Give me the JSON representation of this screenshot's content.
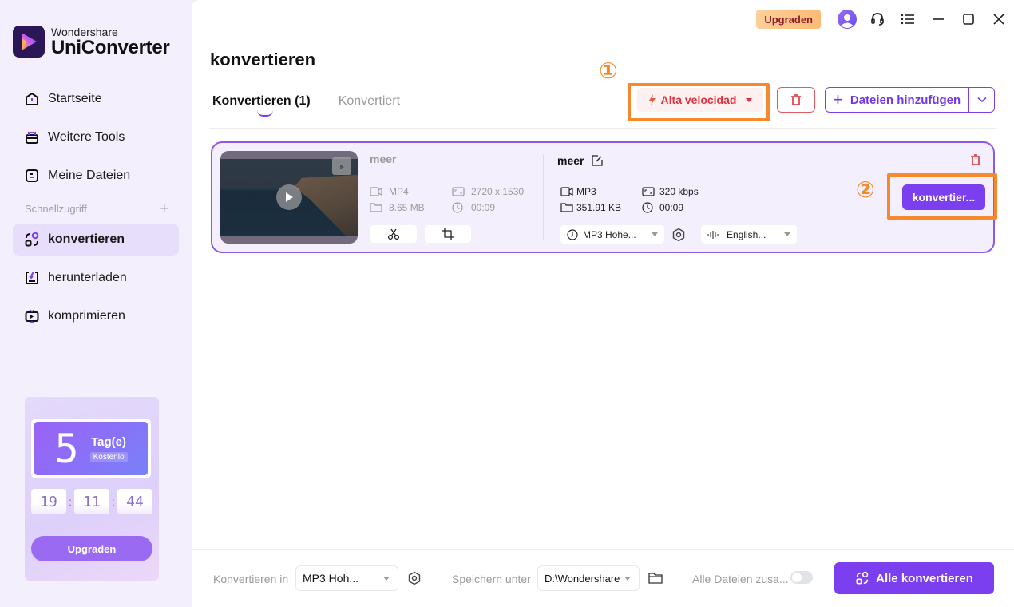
{
  "app": {
    "brand_line1": "Wondershare",
    "brand_line2": "UniConverter"
  },
  "sidebar": {
    "items": [
      {
        "label": "Startseite",
        "icon": "home-icon"
      },
      {
        "label": "Weitere Tools",
        "icon": "toolbox-icon"
      },
      {
        "label": "Meine Dateien",
        "icon": "files-icon"
      }
    ],
    "quick_access_label": "Schnellzugriff",
    "quick_items": [
      {
        "label": "konvertieren",
        "icon": "convert-icon",
        "active": true
      },
      {
        "label": "herunterladen",
        "icon": "download-icon",
        "active": false
      },
      {
        "label": "komprimieren",
        "icon": "compress-icon",
        "active": false
      }
    ],
    "trial": {
      "days": "5",
      "days_label": "Tag(e)",
      "free_label": "Kostenlo",
      "timer_hours": "19",
      "timer_minutes": "11",
      "timer_seconds": "44",
      "upgrade_label": "Upgraden"
    }
  },
  "titlebar": {
    "upgrade_label": "Upgraden"
  },
  "main": {
    "title": "konvertieren",
    "tabs": [
      {
        "label": "Konvertieren (1)",
        "active": true
      },
      {
        "label": "Konvertiert",
        "active": false
      }
    ],
    "annotations": {
      "one": "①",
      "two": "②"
    },
    "speed_label": "Alta velocidad",
    "add_files_label": "Dateien hinzufügen"
  },
  "file": {
    "source": {
      "name": "meer",
      "format": "MP4",
      "resolution": "2720 x 1530",
      "size": "8.65 MB",
      "duration": "00:09"
    },
    "target": {
      "name": "meer",
      "format": "MP3",
      "bitrate": "320 kbps",
      "size": "351.91 KB",
      "duration": "00:09",
      "preset": "MP3 Hohe...",
      "audio_track": "English..."
    },
    "convert_label": "konvertier..."
  },
  "bottom": {
    "convert_to_label": "Konvertieren in",
    "convert_to_value": "MP3 Hoh...",
    "save_to_label": "Speichern unter",
    "save_to_value": "D:\\Wondershare",
    "merge_label": "Alle Dateien zusa...",
    "merge_enabled": false,
    "convert_all_label": "Alle konvertieren"
  },
  "colors": {
    "accent": "#7c3ff0",
    "danger": "#e0313d",
    "highlight": "#f6892d",
    "sidebar_bg": "#f3effc"
  }
}
